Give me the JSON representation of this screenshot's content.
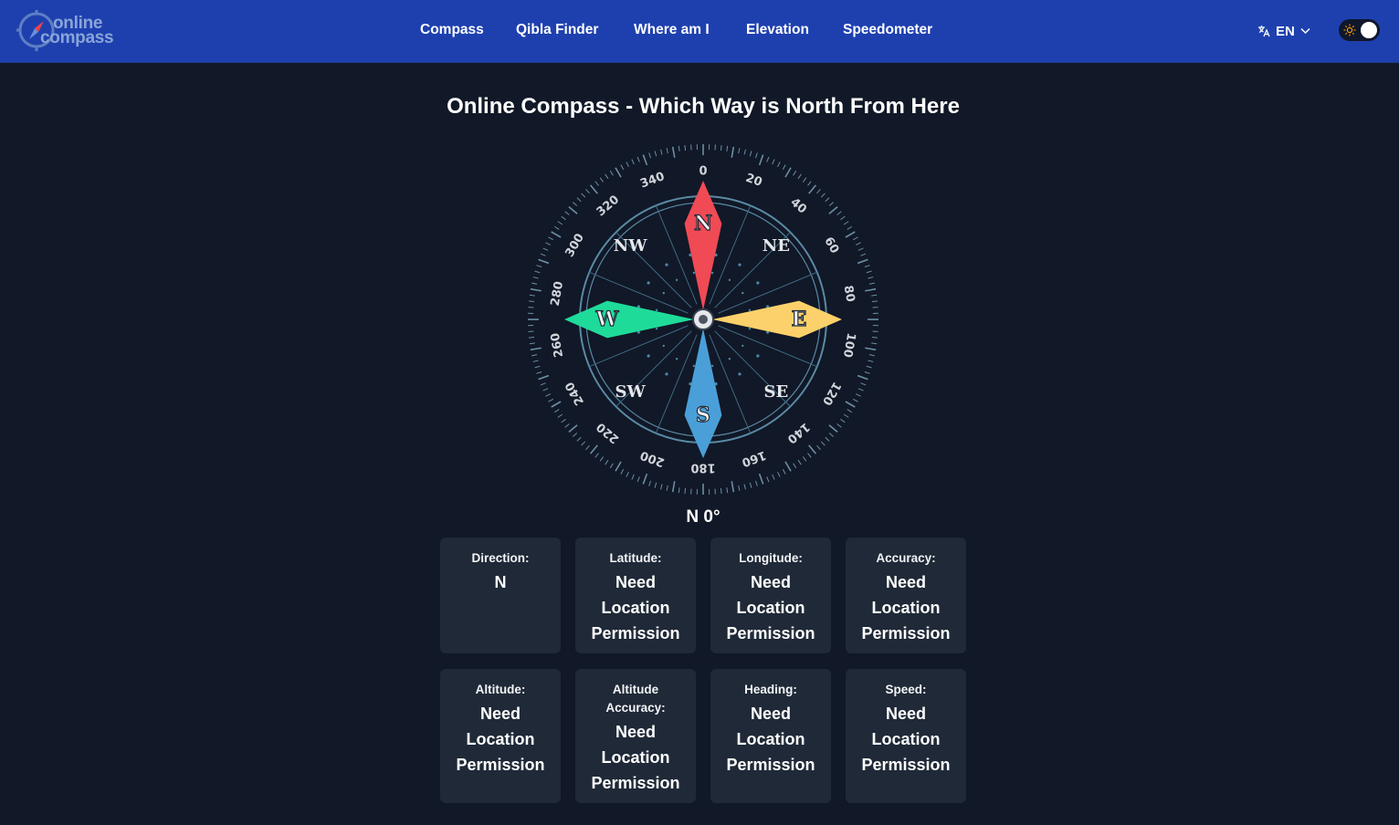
{
  "header": {
    "logo_line1": "online",
    "logo_line2": "compass",
    "nav": [
      {
        "label": "Compass"
      },
      {
        "label": "Qibla Finder"
      },
      {
        "label": "Where am I"
      },
      {
        "label": "Elevation"
      },
      {
        "label": "Speedometer"
      }
    ],
    "language": "EN",
    "theme_toggle": "dark"
  },
  "main": {
    "title": "Online Compass - Which Way is North From Here",
    "compass": {
      "heading_degrees": 0,
      "cardinals": [
        "N",
        "E",
        "S",
        "W"
      ],
      "intercardinals": [
        "NE",
        "SE",
        "SW",
        "NW"
      ],
      "degree_labels": [
        "0",
        "20",
        "40",
        "60",
        "80",
        "100",
        "120",
        "140",
        "160",
        "180",
        "200",
        "220",
        "240",
        "260",
        "280",
        "300",
        "320",
        "340"
      ],
      "colors": {
        "north": "#f04a55",
        "east": "#fcd16b",
        "south": "#4a9fd8",
        "west": "#1fdb9a",
        "ring": "#5a8aa5"
      }
    },
    "readout": "N 0°",
    "cards": [
      {
        "label": "Direction:",
        "value": "N"
      },
      {
        "label": "Latitude:",
        "value": "Need Location Permission"
      },
      {
        "label": "Longitude:",
        "value": "Need Location Permission"
      },
      {
        "label": "Accuracy:",
        "value": "Need Location Permission"
      },
      {
        "label": "Altitude:",
        "value": "Need Location Permission"
      },
      {
        "label": "Altitude Accuracy:",
        "value": "Need Location Permission"
      },
      {
        "label": "Heading:",
        "value": "Need Location Permission"
      },
      {
        "label": "Speed:",
        "value": "Need Location Permission"
      }
    ]
  }
}
